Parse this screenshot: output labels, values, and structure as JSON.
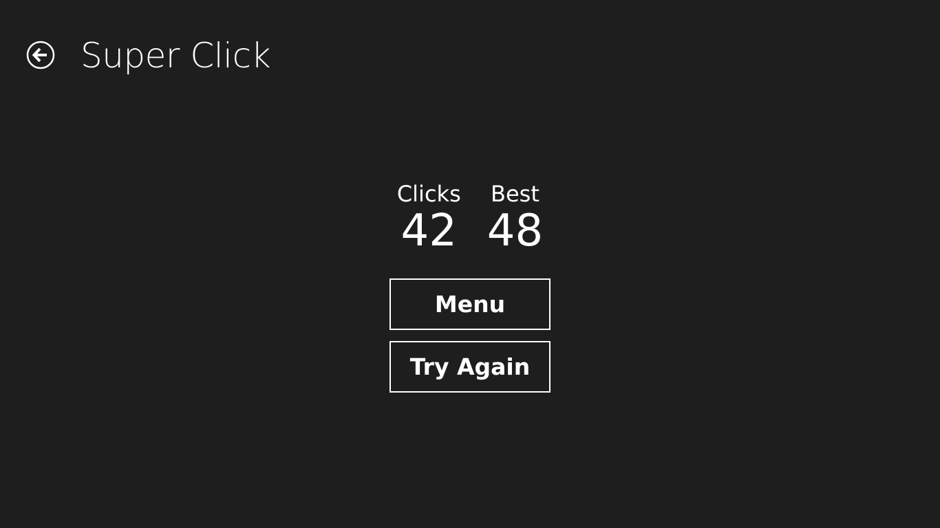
{
  "header": {
    "back_icon": "back-arrow-circle-icon",
    "title": "Super Click"
  },
  "scores": {
    "clicks_label": "Clicks",
    "clicks_value": "42",
    "best_label": "Best",
    "best_value": "48"
  },
  "actions": {
    "menu_label": "Menu",
    "try_again_label": "Try Again"
  },
  "colors": {
    "background": "#1e1e1e",
    "foreground": "#ffffff"
  }
}
